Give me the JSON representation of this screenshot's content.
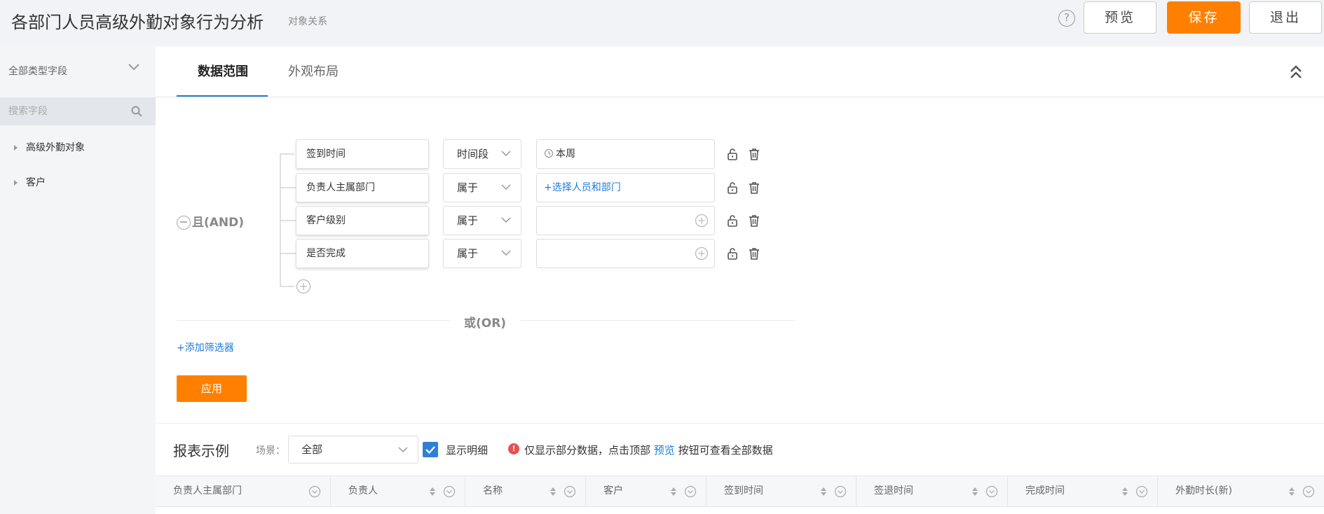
{
  "header": {
    "title": "各部门人员高级外勤对象行为分析",
    "subtitle": "对象关系",
    "help": "?",
    "preview_label": "预览",
    "save_label": "保存",
    "exit_label": "退出"
  },
  "sidebar": {
    "field_type": "全部类型字段",
    "search_placeholder": "搜索字段",
    "items": [
      {
        "label": "高级外勤对象"
      },
      {
        "label": "客户"
      }
    ]
  },
  "tabs": [
    {
      "label": "数据范围",
      "active": true
    },
    {
      "label": "外观布局",
      "active": false
    }
  ],
  "filter": {
    "and_label": "且(AND)",
    "conditions": [
      {
        "field": "签到时间",
        "operator": "时间段",
        "value": "本周",
        "value_type": "time"
      },
      {
        "field": "负责人主属部门",
        "operator": "属于",
        "value": "+选择人员和部门",
        "value_type": "link"
      },
      {
        "field": "客户级别",
        "operator": "属于",
        "value": "",
        "value_type": "empty"
      },
      {
        "field": "是否完成",
        "operator": "属于",
        "value": "",
        "value_type": "empty"
      }
    ],
    "or_label": "或(OR)",
    "add_filter_label": "+添加筛选器",
    "apply_label": "应用"
  },
  "report": {
    "title": "报表示例",
    "scene_label": "场景：",
    "scene_value": "全部",
    "show_detail_label": "显示明细",
    "show_detail_checked": true,
    "info_prefix": "仅显示部分数据，点击顶部",
    "info_link": "预览",
    "info_suffix": "按钮可查看全部数据",
    "columns": [
      {
        "label": "负责人主属部门",
        "sortable": false
      },
      {
        "label": "负责人",
        "sortable": true
      },
      {
        "label": "名称",
        "sortable": true
      },
      {
        "label": "客户",
        "sortable": true
      },
      {
        "label": "签到时间",
        "sortable": true
      },
      {
        "label": "签退时间",
        "sortable": true
      },
      {
        "label": "完成时间",
        "sortable": true
      },
      {
        "label": "外勤时长(新)",
        "sortable": true
      }
    ]
  },
  "colors": {
    "accent": "#ff8000",
    "link": "#1e7cd6",
    "checkbox": "#2f7fd6",
    "warning": "#e8504f"
  }
}
